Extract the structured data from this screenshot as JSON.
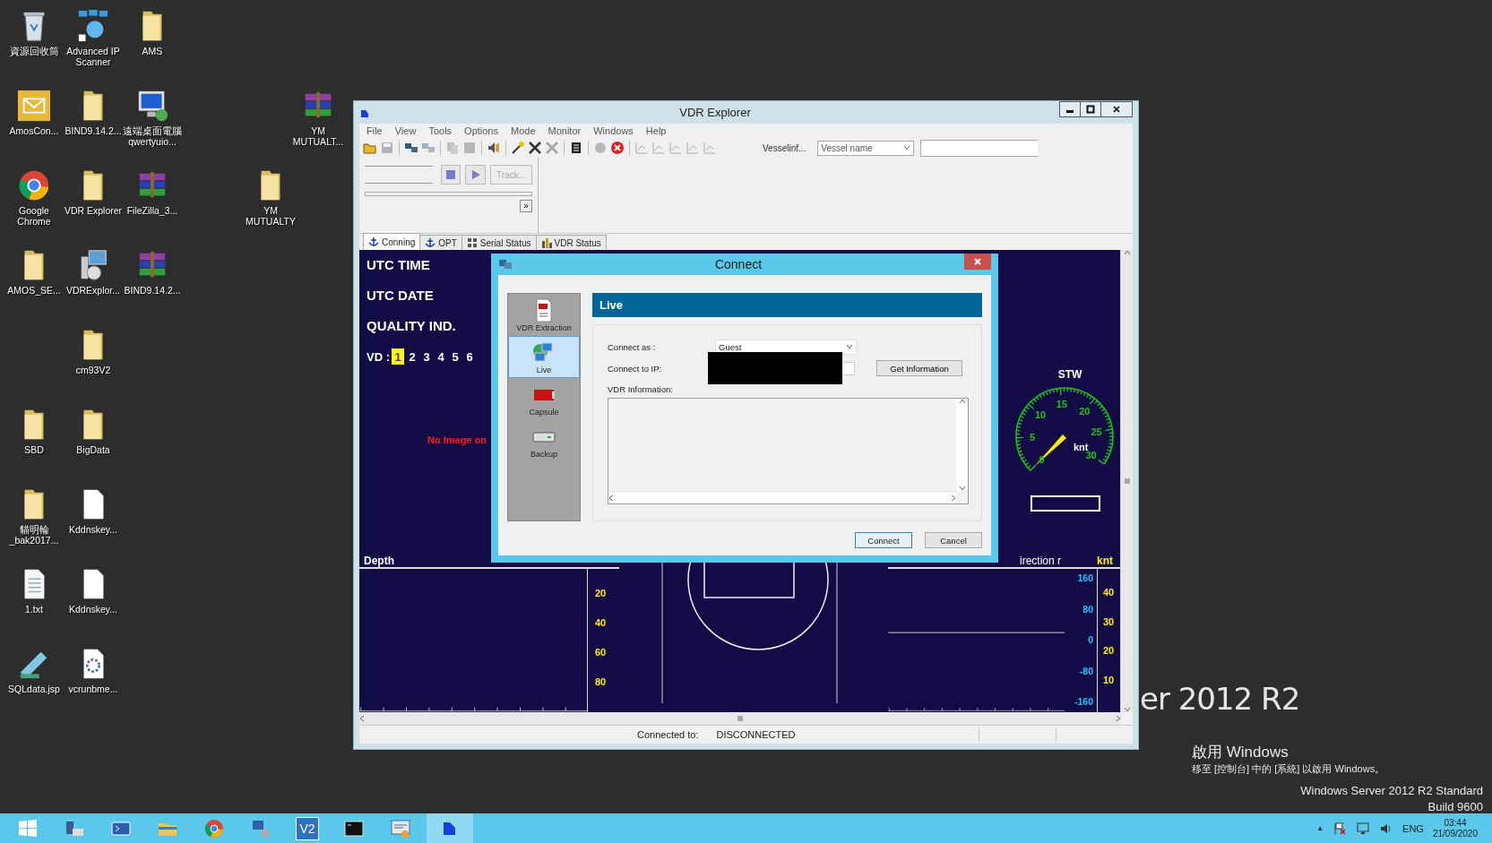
{
  "desktop": {
    "icons": [
      {
        "label": "資源回收筒",
        "kind": "recycle"
      },
      {
        "label": "Advanced IP Scanner",
        "kind": "network"
      },
      {
        "label": "AMS",
        "kind": "folder"
      },
      {
        "label": "AmosCon...",
        "kind": "mail"
      },
      {
        "label": "BIND9.14.2...",
        "kind": "folder"
      },
      {
        "label": "遠端桌面電腦 qwertyuio...",
        "kind": "monitor"
      },
      {
        "label": "YM MUTUALT...",
        "kind": "archive"
      },
      {
        "label": "Google Chrome",
        "kind": "browser"
      },
      {
        "label": "VDR Explorer",
        "kind": "folder"
      },
      {
        "label": "FileZilla_3...",
        "kind": "archive"
      },
      {
        "label": "YM MUTUALTY",
        "kind": "folder"
      },
      {
        "label": "AMOS_SE...",
        "kind": "folder"
      },
      {
        "label": "VDRExplor...",
        "kind": "installer"
      },
      {
        "label": "BIND9.14.2...",
        "kind": "archive"
      },
      {
        "label": "cm93V2",
        "kind": "folder"
      },
      {
        "label": "SBD",
        "kind": "folder"
      },
      {
        "label": "BigData",
        "kind": "folder"
      },
      {
        "label": "貓明輪 _bak2017...",
        "kind": "folder"
      },
      {
        "label": "Kddnskey...",
        "kind": "file"
      },
      {
        "label": "1.txt",
        "kind": "text"
      },
      {
        "label": "Kddnskey...",
        "kind": "file"
      },
      {
        "label": "SQLdata.jsp",
        "kind": "notepad"
      },
      {
        "label": "vcrunbme...",
        "kind": "gearfile"
      }
    ],
    "wallpaper_text": "er 2012 R2",
    "activation": {
      "title": "啟用 Windows",
      "message": "移至 [控制台] 中的 [系統] 以啟用 Windows。"
    },
    "edition": "Windows Server 2012 R2 Standard",
    "build": "Build 9600"
  },
  "window": {
    "title": "VDR Explorer",
    "menu": [
      "File",
      "View",
      "Tools",
      "Options",
      "Mode",
      "Monitor",
      "Windows",
      "Help"
    ],
    "toolbar": [
      {
        "kind": "open",
        "disabled": false
      },
      {
        "kind": "save",
        "disabled": true
      },
      {
        "kind": "sep"
      },
      {
        "kind": "connect",
        "disabled": false
      },
      {
        "kind": "connect",
        "disabled": true
      },
      {
        "kind": "sep"
      },
      {
        "kind": "copy",
        "disabled": true
      },
      {
        "kind": "stop",
        "disabled": true
      },
      {
        "kind": "sep"
      },
      {
        "kind": "audio",
        "disabled": false
      },
      {
        "kind": "sep"
      },
      {
        "kind": "wand",
        "disabled": false
      },
      {
        "kind": "tools",
        "disabled": false
      },
      {
        "kind": "tools",
        "disabled": true
      },
      {
        "kind": "sep"
      },
      {
        "kind": "list",
        "disabled": false
      },
      {
        "kind": "sep"
      },
      {
        "kind": "record",
        "disabled": true
      },
      {
        "kind": "cancel",
        "disabled": false
      },
      {
        "kind": "sep"
      },
      {
        "kind": "chart",
        "disabled": true
      },
      {
        "kind": "chart",
        "disabled": true
      },
      {
        "kind": "chart",
        "disabled": true
      },
      {
        "kind": "chart",
        "disabled": true
      },
      {
        "kind": "chart",
        "disabled": true
      }
    ],
    "vessel_label": "Vesselinf...",
    "vessel_combo": {
      "value": "Vessel name"
    },
    "playback": {
      "track_button": "Track...",
      "expand_button": "»"
    },
    "tabs": [
      {
        "label": "Conning",
        "kind": "anchor",
        "selected": true
      },
      {
        "label": "OPT",
        "kind": "anchor",
        "selected": false
      },
      {
        "label": "Serial Status",
        "kind": "serial",
        "selected": false
      },
      {
        "label": "VDR Status",
        "kind": "bars",
        "selected": false
      }
    ],
    "conning": {
      "labels": [
        "UTC TIME",
        "UTC DATE",
        "QUALITY IND."
      ],
      "vd": {
        "label": "VD :",
        "channels": [
          {
            "label": "1",
            "selected": true
          },
          {
            "label": "2",
            "selected": false
          },
          {
            "label": "3",
            "selected": false
          },
          {
            "label": "4",
            "selected": false
          },
          {
            "label": "5",
            "selected": false
          },
          {
            "label": "6",
            "selected": false
          }
        ]
      },
      "no_image": "No Image on",
      "stw": {
        "title": "STW",
        "unit": "knt",
        "scale": [
          "0",
          "5",
          "10",
          "15",
          "20",
          "25",
          "30"
        ]
      },
      "depth": {
        "title": "Depth",
        "scale": [
          "20",
          "40",
          "60",
          "80"
        ]
      },
      "direction": {
        "title": "irection r",
        "unit": "knt",
        "left_scale": [
          "160",
          "80",
          "0",
          "-80",
          "-160"
        ],
        "right_scale": [
          "40",
          "30",
          "20",
          "10"
        ]
      }
    },
    "status_bar": {
      "label": "Connected to:",
      "value": "DISCONNECTED"
    }
  },
  "dialog": {
    "title": "Connect",
    "nav": [
      {
        "label": "VDR Extraction",
        "kind": "extraction",
        "selected": false
      },
      {
        "label": "Live",
        "kind": "live",
        "selected": true
      },
      {
        "label": "Capsule",
        "kind": "capsule",
        "selected": false
      },
      {
        "label": "Backup",
        "kind": "backup",
        "selected": false
      }
    ],
    "header": "Live",
    "connect_as": {
      "label": "Connect as :",
      "value": "Guest"
    },
    "ip": {
      "label": "Connect to IP:",
      "redacted": true
    },
    "get_info_button": "Get Information",
    "info_label": "VDR Information:",
    "buttons": [
      {
        "label": "Connect",
        "default": true
      },
      {
        "label": "Cancel",
        "default": false
      }
    ]
  },
  "taskbar": {
    "buttons": [
      {
        "kind": "start",
        "selected": false
      },
      {
        "kind": "server",
        "selected": false
      },
      {
        "kind": "shell",
        "selected": false
      },
      {
        "kind": "explorer",
        "selected": false
      },
      {
        "kind": "browser",
        "selected": false
      },
      {
        "kind": "network",
        "selected": false
      },
      {
        "kind": "text",
        "label": "V2",
        "selected": false
      },
      {
        "kind": "console",
        "selected": false
      },
      {
        "kind": "app",
        "selected": false
      },
      {
        "kind": "vdr",
        "selected": true
      }
    ],
    "tray": {
      "expand": "▲",
      "language": "ENG",
      "time": "03:44",
      "date": "21/09/2020"
    }
  }
}
